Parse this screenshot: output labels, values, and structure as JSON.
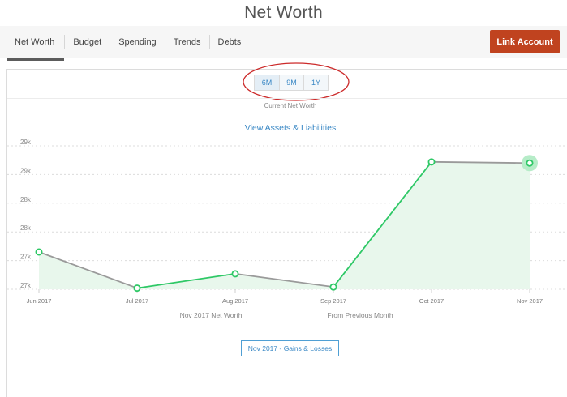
{
  "page": {
    "title": "Net Worth"
  },
  "nav": {
    "tabs": [
      {
        "label": "Net Worth",
        "active": true
      },
      {
        "label": "Budget",
        "active": false
      },
      {
        "label": "Spending",
        "active": false
      },
      {
        "label": "Trends",
        "active": false
      },
      {
        "label": "Debts",
        "active": false
      }
    ],
    "link_account_label": "Link Account"
  },
  "range": {
    "options": [
      "6M",
      "9M",
      "1Y"
    ],
    "selected": "6M"
  },
  "summary": {
    "current_net_worth_label": "Current Net Worth",
    "view_link_label": "View Assets & Liabilities"
  },
  "footer": {
    "left_label": "Nov 2017 Net Worth",
    "right_label": "From Previous Month",
    "gains_button_label": "Nov 2017 - Gains & Losses"
  },
  "colors": {
    "accent_blue": "#3a88c5",
    "button_red": "#c0431f",
    "line_green": "#2ec866",
    "line_gray": "#9a9a9a",
    "area_fill": "#e8f7ec",
    "annotation_red": "#cc2a2a"
  },
  "chart_data": {
    "type": "line",
    "title": "",
    "xlabel": "",
    "ylabel": "",
    "categories": [
      "Jun 2017",
      "Jul 2017",
      "Aug 2017",
      "Sep 2017",
      "Oct 2017",
      "Nov 2017"
    ],
    "y_tick_labels": [
      "29k",
      "29k",
      "28k",
      "28k",
      "27k",
      "27k"
    ],
    "y_ticks": [
      29500,
      29000,
      28500,
      28000,
      27500,
      27000
    ],
    "ylim": [
      27000,
      29500
    ],
    "grid": true,
    "series": [
      {
        "values": [
          27650,
          27020,
          27270,
          27040,
          29220,
          29200
        ]
      }
    ],
    "segment_colors": [
      "gray",
      "green",
      "gray",
      "green",
      "gray"
    ],
    "highlighted_point": "Nov 2017"
  }
}
